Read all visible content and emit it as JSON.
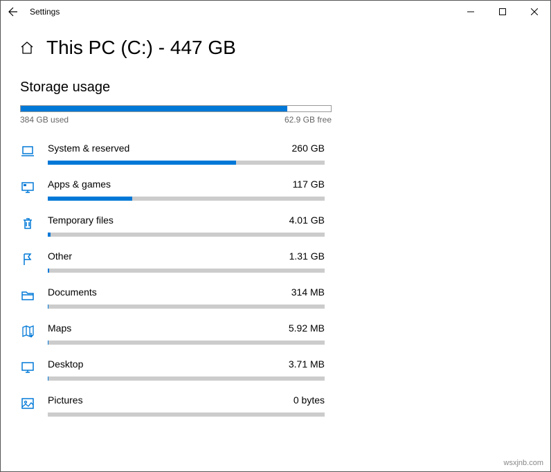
{
  "window": {
    "title": "Settings"
  },
  "page": {
    "title": "This PC (C:) - 447 GB",
    "subtitle": "Storage usage",
    "used_label": "384 GB used",
    "free_label": "62.9 GB free",
    "used_pct": 85.9,
    "total_gb": 447
  },
  "categories": [
    {
      "icon": "laptop-icon",
      "name": "System & reserved",
      "size": "260 GB",
      "pct": 67.9
    },
    {
      "icon": "monitor-icon",
      "name": "Apps & games",
      "size": "117 GB",
      "pct": 30.5
    },
    {
      "icon": "trash-icon",
      "name": "Temporary files",
      "size": "4.01 GB",
      "pct": 1.1
    },
    {
      "icon": "flag-icon",
      "name": "Other",
      "size": "1.31 GB",
      "pct": 0.5
    },
    {
      "icon": "folder-icon",
      "name": "Documents",
      "size": "314 MB",
      "pct": 0.3
    },
    {
      "icon": "map-icon",
      "name": "Maps",
      "size": "5.92 MB",
      "pct": 0.3
    },
    {
      "icon": "desktop-icon",
      "name": "Desktop",
      "size": "3.71 MB",
      "pct": 0.3
    },
    {
      "icon": "picture-icon",
      "name": "Pictures",
      "size": "0 bytes",
      "pct": 0
    }
  ],
  "watermark": "wsxjnb.com"
}
